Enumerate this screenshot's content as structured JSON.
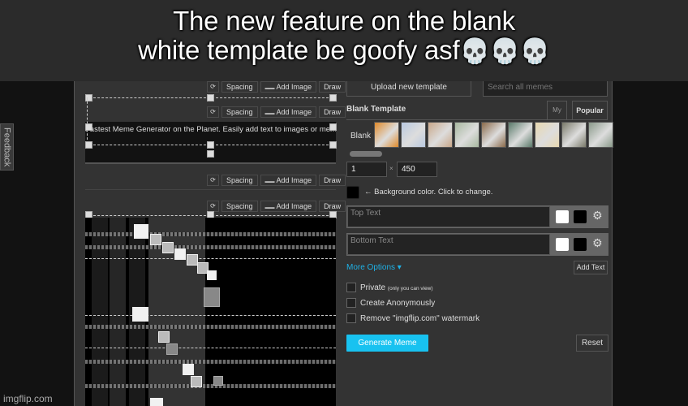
{
  "caption": {
    "line1": "The new feature on the blank",
    "line2": "white template be goofy asf",
    "emoji": "💀💀💀"
  },
  "feedback_label": "Feedback",
  "watermark": "imgflip.com",
  "editor": {
    "toolbar": {
      "rotate_icon": "⟳",
      "spacing": "Spacing",
      "add_image": "Add Image",
      "add_image_icon": "▬▬",
      "draw": "Draw"
    },
    "template_text": "Fastest Meme Generator on the Planet. Easily add text to images or memes."
  },
  "form": {
    "upload_button": "Upload new template",
    "search_placeholder": "Search all memes",
    "section_title": "Blank Template",
    "tabs": [
      {
        "label": "My",
        "active": false
      },
      {
        "label": "Popular",
        "active": true
      }
    ],
    "blank_label": "Blank",
    "thumbnails": [
      {
        "name": "drake",
        "color": "#e08a2a"
      },
      {
        "name": "two-buttons",
        "color": "#b9c9e0"
      },
      {
        "name": "distracted-boyfriend",
        "color": "#c9a88a"
      },
      {
        "name": "bike-fall",
        "color": "#a8b8a0"
      },
      {
        "name": "uno-draw-25",
        "color": "#8a6a4a"
      },
      {
        "name": "left-exit-12",
        "color": "#5a7a6a"
      },
      {
        "name": "buff-doge-vs-cheems",
        "color": "#e8d8b0"
      },
      {
        "name": "bernie",
        "color": "#7a7a6a"
      },
      {
        "name": "running-away",
        "color": "#8a9a8a"
      }
    ],
    "width_value": "1",
    "times": "×",
    "height_value": "450",
    "bg_color": "#000000",
    "bg_label": "← Background color. Click to change.",
    "text_boxes": [
      {
        "placeholder": "Top Text",
        "fill": "#ffffff",
        "outline": "#000000"
      },
      {
        "placeholder": "Bottom Text",
        "fill": "#ffffff",
        "outline": "#000000"
      }
    ],
    "gear_icon": "⚙",
    "more_options": "More Options ▾",
    "add_text": "Add Text",
    "options": [
      {
        "label": "Private",
        "note": "(only you can view)",
        "checked": false
      },
      {
        "label": "Create Anonymously",
        "note": "",
        "checked": false
      },
      {
        "label": "Remove \"imgflip.com\" watermark",
        "note": "",
        "checked": false
      }
    ],
    "generate": "Generate Meme",
    "reset": "Reset",
    "accent": "#18c2f0"
  }
}
